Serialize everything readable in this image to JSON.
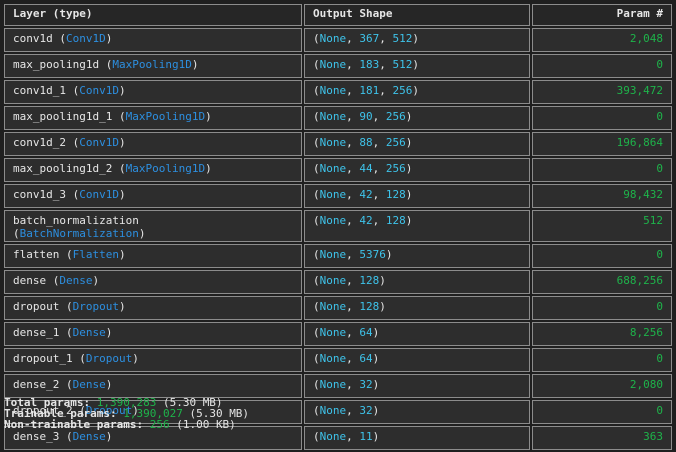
{
  "headers": [
    "Layer (type)",
    "Output Shape",
    "Param #"
  ],
  "rows": [
    {
      "name": "conv1d",
      "type": "Conv1D",
      "shape": [
        "None",
        "367",
        "512"
      ],
      "params": "2,048"
    },
    {
      "name": "max_pooling1d",
      "type": "MaxPooling1D",
      "shape": [
        "None",
        "183",
        "512"
      ],
      "params": "0"
    },
    {
      "name": "conv1d_1",
      "type": "Conv1D",
      "shape": [
        "None",
        "181",
        "256"
      ],
      "params": "393,472"
    },
    {
      "name": "max_pooling1d_1",
      "type": "MaxPooling1D",
      "shape": [
        "None",
        "90",
        "256"
      ],
      "params": "0"
    },
    {
      "name": "conv1d_2",
      "type": "Conv1D",
      "shape": [
        "None",
        "88",
        "256"
      ],
      "params": "196,864"
    },
    {
      "name": "max_pooling1d_2",
      "type": "MaxPooling1D",
      "shape": [
        "None",
        "44",
        "256"
      ],
      "params": "0"
    },
    {
      "name": "conv1d_3",
      "type": "Conv1D",
      "shape": [
        "None",
        "42",
        "128"
      ],
      "params": "98,432"
    },
    {
      "name": "batch_normalization",
      "type": "BatchNormalization",
      "shape": [
        "None",
        "42",
        "128"
      ],
      "params": "512",
      "wrap_type": true
    },
    {
      "name": "flatten",
      "type": "Flatten",
      "shape": [
        "None",
        "5376"
      ],
      "params": "0"
    },
    {
      "name": "dense",
      "type": "Dense",
      "shape": [
        "None",
        "128"
      ],
      "params": "688,256"
    },
    {
      "name": "dropout",
      "type": "Dropout",
      "shape": [
        "None",
        "128"
      ],
      "params": "0"
    },
    {
      "name": "dense_1",
      "type": "Dense",
      "shape": [
        "None",
        "64"
      ],
      "params": "8,256"
    },
    {
      "name": "dropout_1",
      "type": "Dropout",
      "shape": [
        "None",
        "64"
      ],
      "params": "0"
    },
    {
      "name": "dense_2",
      "type": "Dense",
      "shape": [
        "None",
        "32"
      ],
      "params": "2,080"
    },
    {
      "name": "dropout_2",
      "type": "Dropout",
      "shape": [
        "None",
        "32"
      ],
      "params": "0"
    },
    {
      "name": "dense_3",
      "type": "Dense",
      "shape": [
        "None",
        "11"
      ],
      "params": "363"
    }
  ],
  "summary": {
    "total_label": "Total params:",
    "total_value": "1,390,283",
    "total_size": "(5.30 MB)",
    "trainable_label": "Trainable params:",
    "trainable_value": "1,390,027",
    "trainable_size": "(5.30 MB)",
    "nontrainable_label": "Non-trainable params:",
    "nontrainable_value": "256",
    "nontrainable_size": "(1.00 KB)"
  },
  "colors": {
    "shape_numbers": "#3ec3ea",
    "layer_type": "#2d8fe0",
    "params": "#1eb34a",
    "border": "#8c8c8c",
    "background": "#1f1f1f"
  }
}
